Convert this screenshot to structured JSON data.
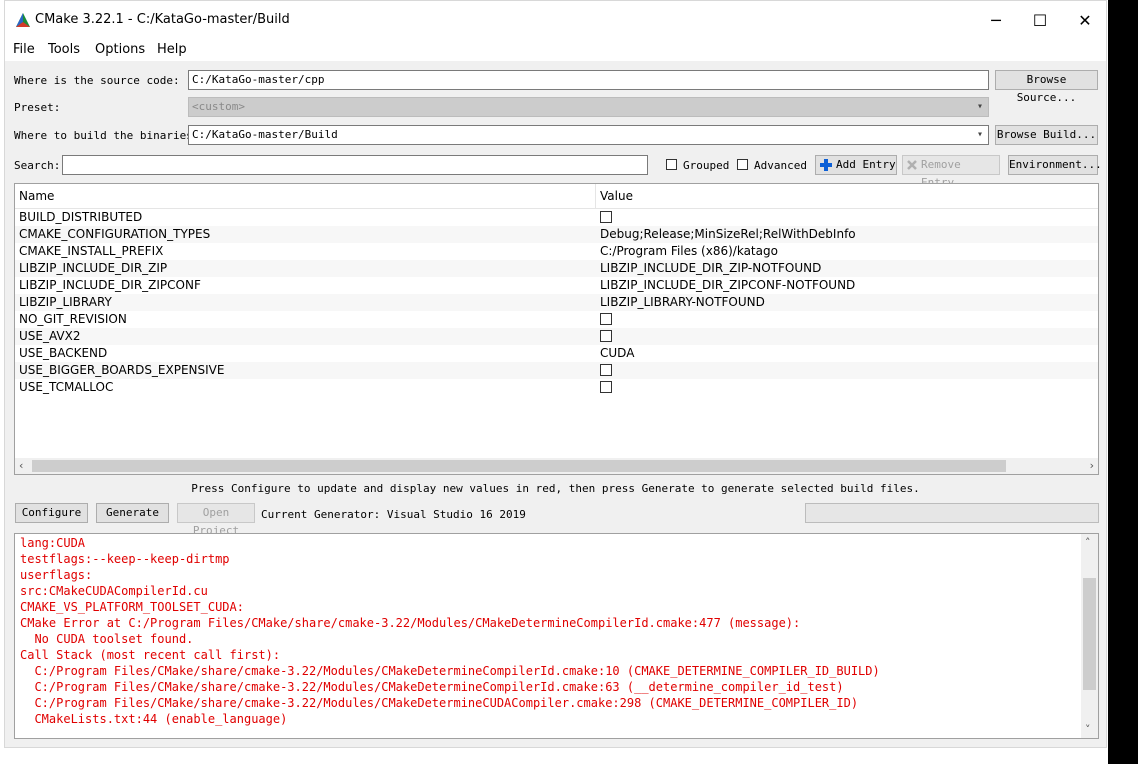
{
  "window": {
    "title": "CMake 3.22.1 - C:/KataGo-master/Build",
    "controls": {
      "minimize": "─",
      "maximize": "☐",
      "close": "✕"
    }
  },
  "menu": [
    "File",
    "Tools",
    "Options",
    "Help"
  ],
  "source": {
    "label": "Where is the source code:",
    "value": "C:/KataGo-master/cpp",
    "button": "Browse Source..."
  },
  "preset": {
    "label": "Preset:",
    "value": "<custom>"
  },
  "build": {
    "label": "Where to build the binaries:",
    "value": "C:/KataGo-master/Build",
    "button": "Browse Build..."
  },
  "search": {
    "label": "Search:",
    "value": "",
    "grouped": "Grouped",
    "advanced": "Advanced",
    "add_entry": "Add Entry",
    "remove_entry": "Remove Entry",
    "environment": "Environment..."
  },
  "table": {
    "headers": {
      "name": "Name",
      "value": "Value"
    },
    "rows": [
      {
        "name": "BUILD_DISTRIBUTED",
        "value": "",
        "type": "bool"
      },
      {
        "name": "CMAKE_CONFIGURATION_TYPES",
        "value": "Debug;Release;MinSizeRel;RelWithDebInfo",
        "type": "string"
      },
      {
        "name": "CMAKE_INSTALL_PREFIX",
        "value": "C:/Program Files (x86)/katago",
        "type": "string"
      },
      {
        "name": "LIBZIP_INCLUDE_DIR_ZIP",
        "value": "LIBZIP_INCLUDE_DIR_ZIP-NOTFOUND",
        "type": "string"
      },
      {
        "name": "LIBZIP_INCLUDE_DIR_ZIPCONF",
        "value": "LIBZIP_INCLUDE_DIR_ZIPCONF-NOTFOUND",
        "type": "string"
      },
      {
        "name": "LIBZIP_LIBRARY",
        "value": "LIBZIP_LIBRARY-NOTFOUND",
        "type": "string"
      },
      {
        "name": "NO_GIT_REVISION",
        "value": "",
        "type": "bool"
      },
      {
        "name": "USE_AVX2",
        "value": "",
        "type": "bool"
      },
      {
        "name": "USE_BACKEND",
        "value": "CUDA",
        "type": "string"
      },
      {
        "name": "USE_BIGGER_BOARDS_EXPENSIVE",
        "value": "",
        "type": "bool"
      },
      {
        "name": "USE_TCMALLOC",
        "value": "",
        "type": "bool"
      }
    ]
  },
  "hint": "Press Configure to update and display new values in red, then press Generate to generate selected build files.",
  "actions": {
    "configure": "Configure",
    "generate": "Generate",
    "open_project": "Open Project",
    "generator": "Current Generator: Visual Studio 16 2019"
  },
  "output_lines": [
    "lang:CUDA",
    "testflags:--keep--keep-dirtmp",
    "userflags:",
    "src:CMakeCUDACompilerId.cu",
    "CMAKE_VS_PLATFORM_TOOLSET_CUDA:",
    "CMake Error at C:/Program Files/CMake/share/cmake-3.22/Modules/CMakeDetermineCompilerId.cmake:477 (message):",
    "  No CUDA toolset found.",
    "Call Stack (most recent call first):",
    "  C:/Program Files/CMake/share/cmake-3.22/Modules/CMakeDetermineCompilerId.cmake:10 (CMAKE_DETERMINE_COMPILER_ID_BUILD)",
    "  C:/Program Files/CMake/share/cmake-3.22/Modules/CMakeDetermineCompilerId.cmake:63 (__determine_compiler_id_test)",
    "  C:/Program Files/CMake/share/cmake-3.22/Modules/CMakeDetermineCUDACompiler.cmake:298 (CMAKE_DETERMINE_COMPILER_ID)",
    "  CMakeLists.txt:44 (enable_language)"
  ],
  "colors": {
    "error": "#e00000",
    "accent": "#0b5fd6"
  }
}
